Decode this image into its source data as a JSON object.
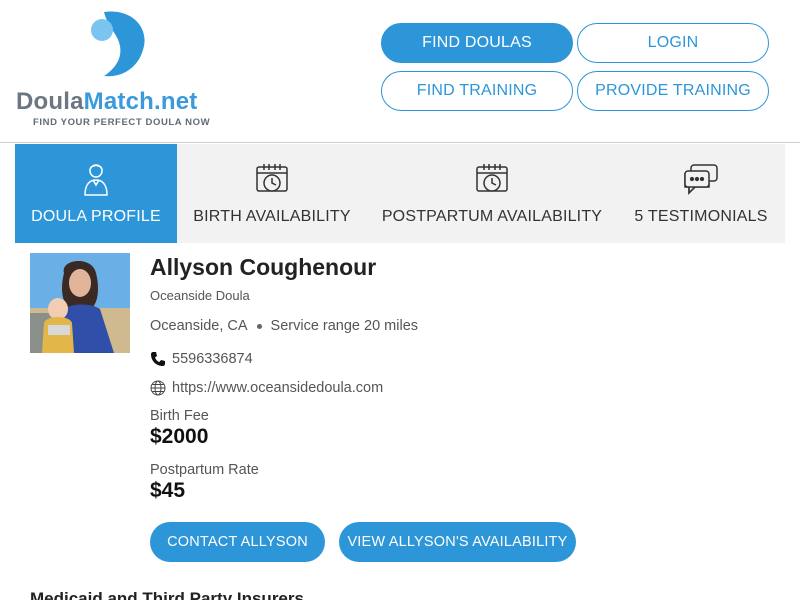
{
  "brand": {
    "name_part1": "Doula",
    "name_part2": "Match.net",
    "tagline": "FIND YOUR PERFECT DOULA NOW",
    "colors": {
      "primary": "#2d96d9",
      "logo_gray": "#6c7783",
      "logo_light": "#7cc4f0"
    }
  },
  "header": {
    "buttons": {
      "find_doulas": "FIND DOULAS",
      "login": "LOGIN",
      "find_training": "FIND TRAINING",
      "provide_training": "PROVIDE TRAINING"
    }
  },
  "tabs": [
    {
      "label": "DOULA PROFILE",
      "icon": "person-icon",
      "active": true
    },
    {
      "label": "BIRTH AVAILABILITY",
      "icon": "calendar-clock-icon",
      "active": false
    },
    {
      "label": "POSTPARTUM AVAILABILITY",
      "icon": "calendar-clock-icon",
      "active": false
    },
    {
      "label": "5 TESTIMONIALS",
      "icon": "chat-bubbles-icon",
      "active": false
    }
  ],
  "profile": {
    "name": "Allyson Coughenour",
    "subtitle": "Oceanside Doula",
    "city": "Oceanside, CA",
    "service_range": "Service range 20 miles",
    "phone": "5596336874",
    "website": "https://www.oceansidedoula.com",
    "birth_fee_label": "Birth Fee",
    "birth_fee": "$2000",
    "postpartum_label": "Postpartum Rate",
    "postpartum_rate": "$45"
  },
  "actions": {
    "contact": "CONTACT ALLYSON",
    "availability": "VIEW ALLYSON'S AVAILABILITY"
  },
  "section": {
    "heading": "Medicaid and Third Party Insurers"
  }
}
